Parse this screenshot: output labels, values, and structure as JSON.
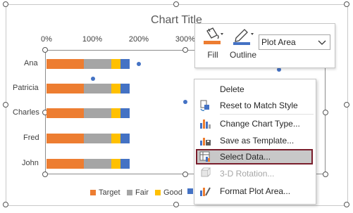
{
  "chart": {
    "title": "Chart Title",
    "x_ticks": [
      "0%",
      "100%",
      "200%",
      "300%"
    ],
    "categories": [
      "Ana",
      "Patricia",
      "Charles",
      "Fred",
      "John"
    ],
    "legend": [
      {
        "label": "Target",
        "color": "#ed7d31"
      },
      {
        "label": "Fair",
        "color": "#a5a5a5"
      },
      {
        "label": "Good",
        "color": "#ffc000"
      },
      {
        "label": "",
        "color": "#4472c4"
      }
    ]
  },
  "chart_data": {
    "type": "bar",
    "title": "Chart Title",
    "categories": [
      "Ana",
      "Patricia",
      "Charles",
      "Fred",
      "John"
    ],
    "xlim": [
      0,
      3
    ],
    "series": [
      {
        "name": "Target",
        "values": [
          0.8,
          0.8,
          0.8,
          0.8,
          0.8
        ]
      },
      {
        "name": "Fair",
        "values": [
          0.6,
          0.6,
          0.6,
          0.6,
          0.6
        ]
      },
      {
        "name": "Good",
        "values": [
          0.2,
          0.2,
          0.2,
          0.2,
          0.2
        ]
      },
      {
        "values": [
          0.2,
          0.2,
          0.2,
          0.2,
          0.2
        ]
      }
    ],
    "scatter_points": [
      {
        "x": 2.0,
        "category": "Ana"
      },
      {
        "x": 1.0,
        "category": "Patricia"
      },
      {
        "x": 3.0,
        "category": "Charles"
      },
      {
        "x": 3.0,
        "category": "Fred"
      },
      {
        "x": 3.0,
        "category": "John"
      }
    ]
  },
  "toolbar": {
    "fill_label": "Fill",
    "outline_label": "Outline",
    "element_selector": "Plot Area",
    "fill_color": "#ed7d31",
    "outline_color": "#4472c4"
  },
  "context_menu": {
    "items": [
      {
        "label": "Delete",
        "icon": "none",
        "enabled": true
      },
      {
        "label": "Reset to Match Style",
        "icon": "reset-style-icon",
        "enabled": true
      },
      {
        "label": "Change Chart Type...",
        "icon": "change-chart-type-icon",
        "enabled": true
      },
      {
        "label": "Save as Template...",
        "icon": "save-template-icon",
        "enabled": true
      },
      {
        "label": "Select Data...",
        "icon": "select-data-icon",
        "enabled": true,
        "selected": true
      },
      {
        "label": "3-D Rotation...",
        "icon": "rotation-3d-icon",
        "enabled": false
      },
      {
        "label": "Format Plot Area...",
        "icon": "format-plot-area-icon",
        "enabled": true
      }
    ]
  }
}
